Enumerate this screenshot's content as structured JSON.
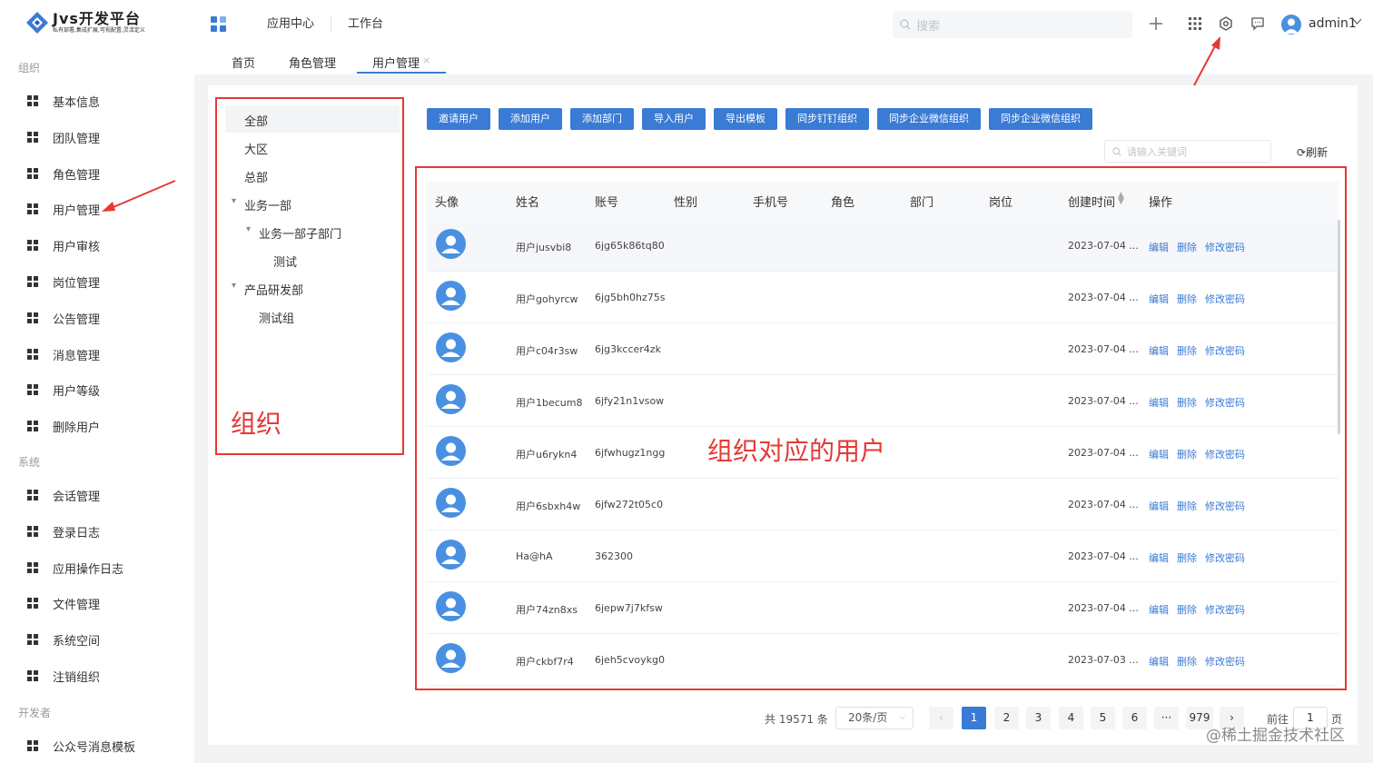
{
  "app": {
    "logo_title": "Jvs开发平台",
    "logo_subtitle": "私有部署,集成扩展,可视配置,灵活定义",
    "brand_color": "#3a7bd5"
  },
  "topbar": {
    "nav": [
      "应用中心",
      "工作台"
    ],
    "search_placeholder": "搜索",
    "icons": [
      "plus-icon",
      "apps-grid-icon",
      "settings-gear-icon",
      "message-icon"
    ],
    "user_name": "admin1"
  },
  "sidebar": {
    "groups": [
      {
        "label": "组织",
        "items": [
          "基本信息",
          "团队管理",
          "角色管理",
          "用户管理",
          "用户审核",
          "岗位管理",
          "公告管理",
          "消息管理",
          "用户等级",
          "删除用户"
        ]
      },
      {
        "label": "系统",
        "items": [
          "会话管理",
          "登录日志",
          "应用操作日志",
          "文件管理",
          "系统空间",
          "注销组织"
        ]
      },
      {
        "label": "开发者",
        "items": [
          "公众号消息模板"
        ]
      }
    ]
  },
  "tabs": [
    {
      "label": "首页",
      "active": false
    },
    {
      "label": "角色管理",
      "active": false
    },
    {
      "label": "用户管理",
      "active": true,
      "close": "×"
    }
  ],
  "tree": {
    "items": [
      {
        "label": "全部",
        "level": 0,
        "expand": ""
      },
      {
        "label": "大区",
        "level": 0,
        "expand": ""
      },
      {
        "label": "总部",
        "level": 0,
        "expand": ""
      },
      {
        "label": "业务一部",
        "level": 0,
        "expand": "▾"
      },
      {
        "label": "业务一部子部门",
        "level": 1,
        "expand": "▾"
      },
      {
        "label": "测试",
        "level": 2,
        "expand": ""
      },
      {
        "label": "产品研发部",
        "level": 0,
        "expand": "▾"
      },
      {
        "label": "测试组",
        "level": 1,
        "expand": ""
      }
    ]
  },
  "annotations": {
    "org_label": "组织",
    "users_label": "组织对应的用户",
    "color": "#e53935"
  },
  "toolbar": {
    "buttons": [
      "邀请用户",
      "添加用户",
      "添加部门",
      "导入用户",
      "导出模板",
      "同步钉钉组织",
      "同步企业微信组织",
      "同步企业微信组织"
    ],
    "keyword_placeholder": "请输入关键词",
    "refresh_label": "刷新"
  },
  "table": {
    "columns": [
      "头像",
      "姓名",
      "账号",
      "性别",
      "手机号",
      "角色",
      "部门",
      "岗位",
      "创建时间",
      "操作"
    ],
    "actions": [
      "编辑",
      "删除",
      "修改密码"
    ],
    "rows": [
      {
        "name": "用户jusvbi8",
        "account": "6jg65k86tq80",
        "created": "2023-07-04 ..."
      },
      {
        "name": "用户gohyrcw",
        "account": "6jg5bh0hz75s",
        "created": "2023-07-04 ..."
      },
      {
        "name": "用户c04r3sw",
        "account": "6jg3kccer4zk",
        "created": "2023-07-04 ..."
      },
      {
        "name": "用户1becum8",
        "account": "6jfy21n1vsow",
        "created": "2023-07-04 ..."
      },
      {
        "name": "用户u6rykn4",
        "account": "6jfwhugz1ngg",
        "created": "2023-07-04 ..."
      },
      {
        "name": "用户6sbxh4w",
        "account": "6jfw272t05c0",
        "created": "2023-07-04 ..."
      },
      {
        "name": "Ha@hA",
        "account": "362300",
        "created": "2023-07-04 ..."
      },
      {
        "name": "用户74zn8xs",
        "account": "6jepw7j7kfsw",
        "created": "2023-07-04 ..."
      },
      {
        "name": "用户ckbf7r4",
        "account": "6jeh5cvoykg0",
        "created": "2023-07-03 ..."
      }
    ]
  },
  "pagination": {
    "total_text": "共 19571 条",
    "page_size": "20条/页",
    "pages": [
      "1",
      "2",
      "3",
      "4",
      "5",
      "6",
      "···",
      "979"
    ],
    "current": "1",
    "prev": "‹",
    "next": "›",
    "goto_label": "前往",
    "goto_value": "1",
    "page_suffix": "页"
  },
  "watermark": "@稀土掘金技术社区"
}
